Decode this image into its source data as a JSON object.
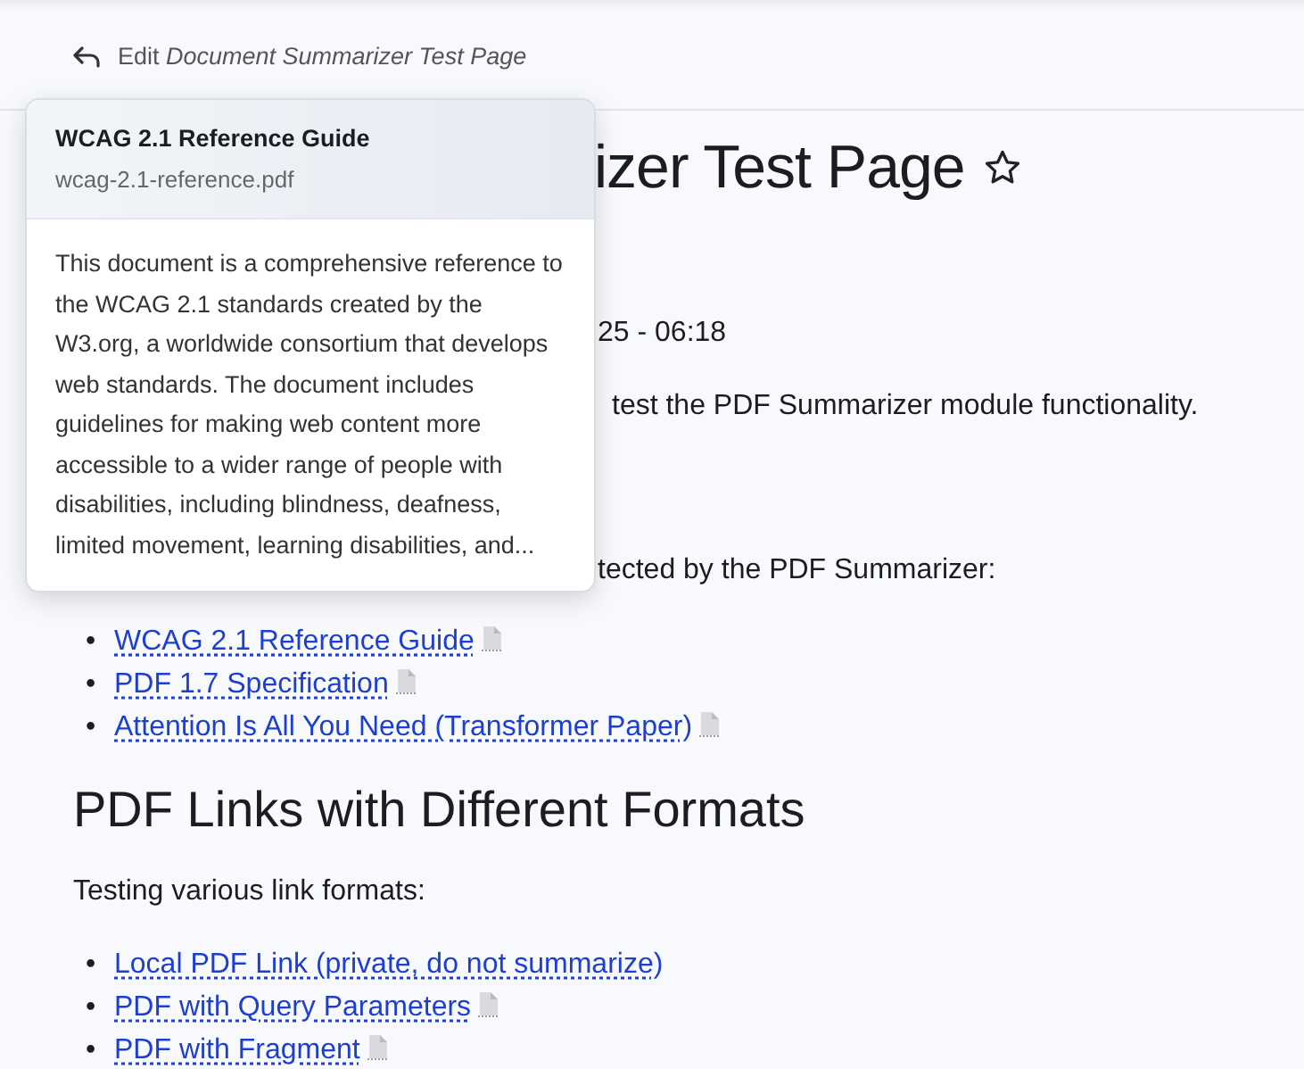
{
  "header": {
    "edit_label": "Edit",
    "page_title": "Document Summarizer Test Page"
  },
  "popover": {
    "title": "WCAG 2.1 Reference Guide",
    "filename": "wcag-2.1-reference.pdf",
    "summary": "This document is a comprehensive reference to the WCAG 2.1 standards created by the W3.org, a worldwide consortium that develops web standards. The document includes guidelines for making web content more accessible to a wider range of people with disabilities, including blindness, deafness, limited movement, learning disabilities, and..."
  },
  "content": [
    {
      "kind": "title",
      "text": "izer Test Page",
      "starred": false
    },
    {
      "kind": "text",
      "text": "25 - 06:18"
    },
    {
      "kind": "text",
      "text": "test the PDF Summarizer module functionality."
    },
    {
      "kind": "text",
      "text": "tected by the PDF Summarizer:"
    },
    {
      "kind": "list",
      "bullet": "•",
      "items": [
        {
          "text": "WCAG 2.1 Reference Guide",
          "file_icon": true
        },
        {
          "text": "PDF 1.7 Specification",
          "file_icon": true
        },
        {
          "text": "Attention Is All You Need (Transformer Paper)",
          "file_icon": true
        }
      ]
    },
    {
      "kind": "heading",
      "text": "PDF Links with Different Formats"
    },
    {
      "kind": "paragraph",
      "text": "Testing various link formats:"
    },
    {
      "kind": "list",
      "bullet": "•",
      "items": [
        {
          "text": "Local PDF Link (private, do not summarize)",
          "file_icon": false
        },
        {
          "text": "PDF with Query Parameters",
          "file_icon": true
        },
        {
          "text": "PDF with Fragment",
          "file_icon": true
        }
      ]
    }
  ]
}
